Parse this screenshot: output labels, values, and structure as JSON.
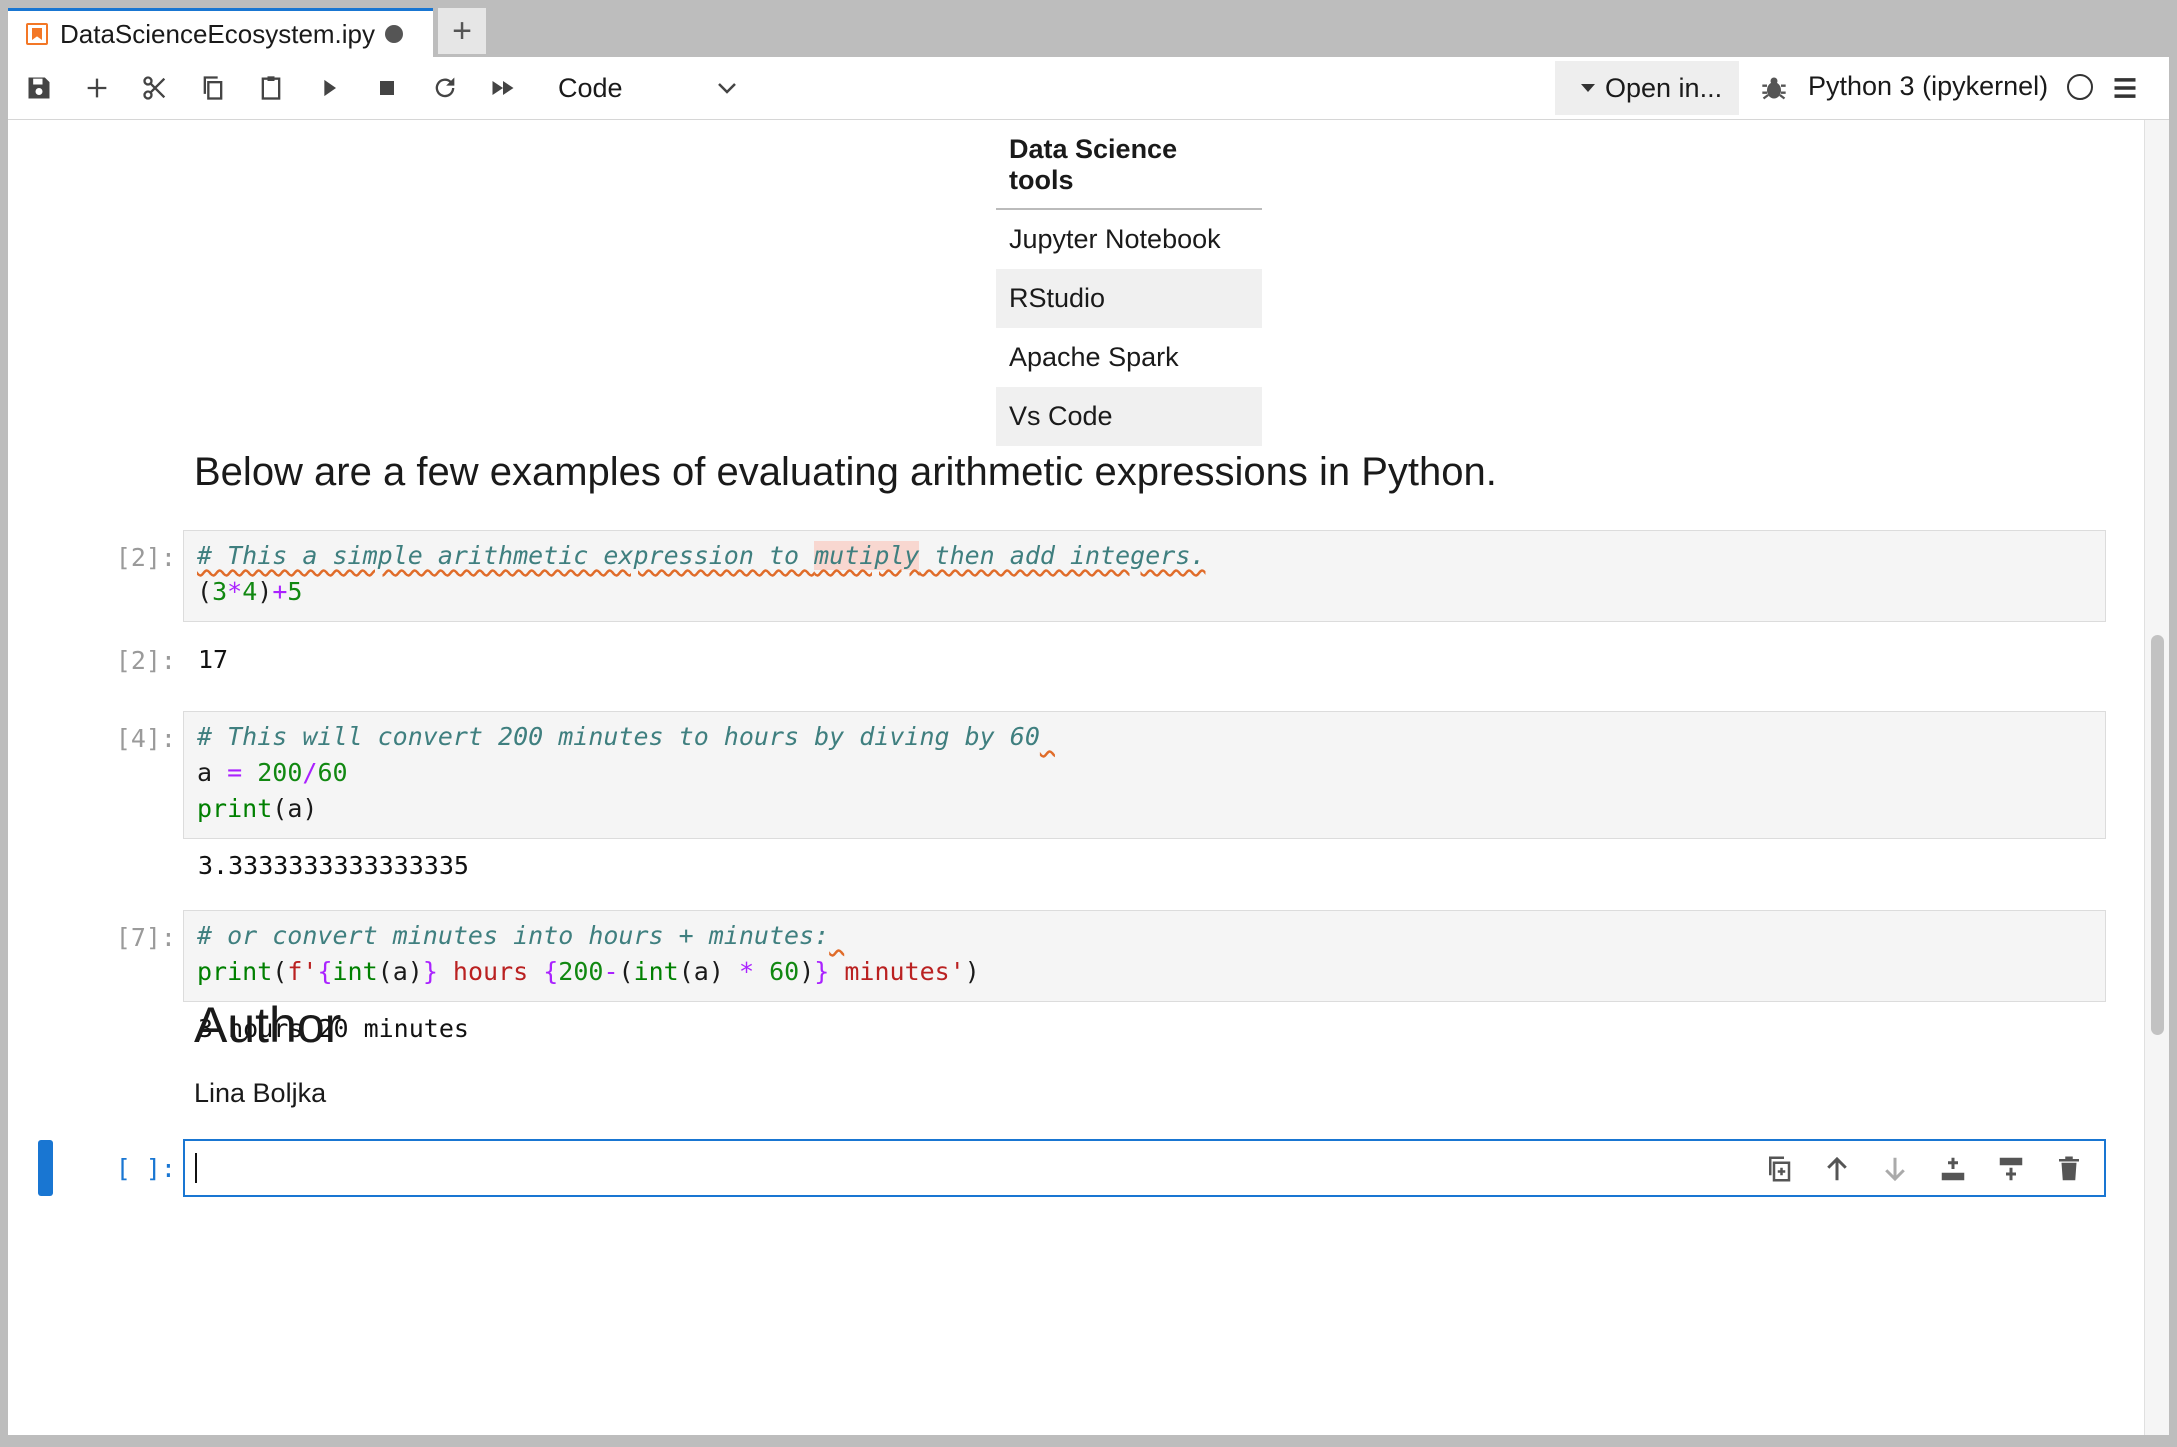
{
  "tab": {
    "title": "DataScienceEcosystem.ipy",
    "add_label": "+"
  },
  "toolbar": {
    "cell_type": "Code",
    "open_in": "Open in...",
    "kernel": "Python 3 (ipykernel)",
    "icons": [
      "save-icon",
      "add-icon",
      "cut-icon",
      "copy-icon",
      "paste-icon",
      "run-icon",
      "stop-icon",
      "restart-icon",
      "run-all-icon",
      "bug-icon",
      "menu-icon"
    ]
  },
  "table": {
    "header": "Data Science tools",
    "rows": [
      "Jupyter Notebook",
      "RStudio",
      "Apache Spark",
      "Vs Code"
    ]
  },
  "intro": "Below are a few examples of evaluating arithmetic expressions in Python.",
  "cells": [
    {
      "prompt": "[2]:",
      "output_prompt": "[2]:",
      "output": "17"
    },
    {
      "prompt": "[4]:",
      "output": "3.3333333333333335"
    },
    {
      "prompt": "[7]:",
      "output": "3 hours 20 minutes"
    }
  ],
  "author": {
    "heading": "Author",
    "name": "Lina Boljka"
  },
  "active_cell": {
    "prompt": "[ ]:"
  }
}
